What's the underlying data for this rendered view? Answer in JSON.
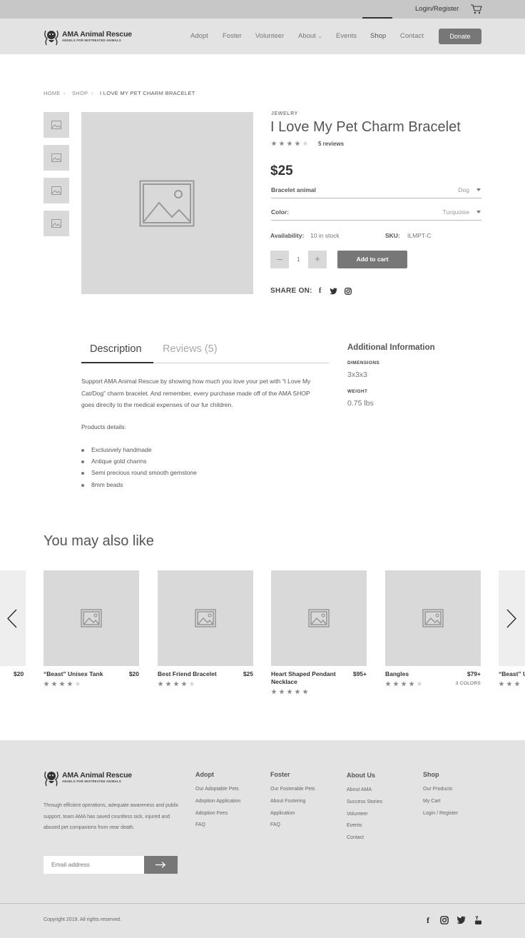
{
  "topbar": {
    "login_label": "Login/Register",
    "cart_icon": "cart-icon"
  },
  "brand": {
    "name": "AMA Animal Rescue",
    "tagline": "ANGELS FOR MISTREATED ANIMALS"
  },
  "nav": {
    "items": [
      "Adopt",
      "Foster",
      "Volunteer",
      "About",
      "Events",
      "Shop",
      "Contact"
    ],
    "active": "Shop",
    "donate_label": "Donate"
  },
  "breadcrumb": [
    "HOME",
    "SHOP",
    "I LOVE MY PET CHARM BRACELET"
  ],
  "product": {
    "category": "JEWELRY",
    "title": "I Love My Pet Charm Bracelet",
    "rating": 4,
    "reviews_label": "5 reviews",
    "price": "$25",
    "options": [
      {
        "label": "Bracelet animal",
        "value": "Dog"
      },
      {
        "label": "Color:",
        "value": "Turquoise"
      }
    ],
    "availability_label": "Availability:",
    "availability_value": "10 in stock",
    "sku_label": "SKU:",
    "sku_value": "ILMPT-C",
    "quantity": "1",
    "add_to_cart_label": "Add to cart",
    "share_label": "SHARE ON:"
  },
  "tabs": {
    "description": "Description",
    "reviews": "Reviews (5)",
    "active": "Description"
  },
  "description": {
    "text": "Support AMA Animal Rescue by showing how much you love your pet with “I Love My Cat/Dog” charm bracelet. And remember, every purchase made off of the AMA SHOP goes directly to the medical expenses of our fur children.",
    "details_heading": "Products details:",
    "bullets": [
      "Exclusively handmade",
      "Antique gold charms",
      "Semi precious round smooth gemstone",
      "8mm beads"
    ]
  },
  "additional_info": {
    "heading": "Additional Information",
    "dimensions_label": "DIMENSIONS",
    "dimensions_value": "3x3x3",
    "weight_label": "WEIGHT",
    "weight_value": "0.75 lbs"
  },
  "related": {
    "heading": "You may also like",
    "left_partial_price": "$20",
    "right_partial_name": "“Beast” U",
    "items": [
      {
        "name": "“Beast” Unisex Tank",
        "price": "$20",
        "rating": 4,
        "colors": ""
      },
      {
        "name": "Best Friend Bracelet",
        "price": "$25",
        "rating": 4,
        "colors": ""
      },
      {
        "name": "Heart Shaped Pendant Necklace",
        "price": "$95+",
        "rating": 5,
        "colors": ""
      },
      {
        "name": "Bangles",
        "price": "$79+",
        "rating": 4,
        "colors": "3 COLORS"
      }
    ]
  },
  "footer": {
    "description": "Through efficient operations, adequate awareness and public support, team AMA has saved countless sick, injured and abused pet companions from near death.",
    "email_placeholder": "Email address",
    "columns": [
      {
        "heading": "Adopt",
        "links": [
          "Our Adoptable Pets",
          "Adoption Application",
          "Adoption Fees",
          "FAQ"
        ]
      },
      {
        "heading": "Foster",
        "links": [
          "Our Fosterable Pets",
          "About Fostering",
          "Application",
          "FAQ"
        ]
      },
      {
        "heading": "About Us",
        "links": [
          "About AMA",
          "Success Stories",
          "Volunteer",
          "Events",
          "Contact"
        ]
      },
      {
        "heading": "Shop",
        "links": [
          "Our Products",
          "My Cart",
          "Login / Register"
        ]
      }
    ],
    "copyright": "Copyright 2019. All rights reserved."
  },
  "colors": {
    "dark_button": "#777777",
    "wire_gray": "#d9d9d9",
    "bar_gray": "#e3e3e3"
  }
}
